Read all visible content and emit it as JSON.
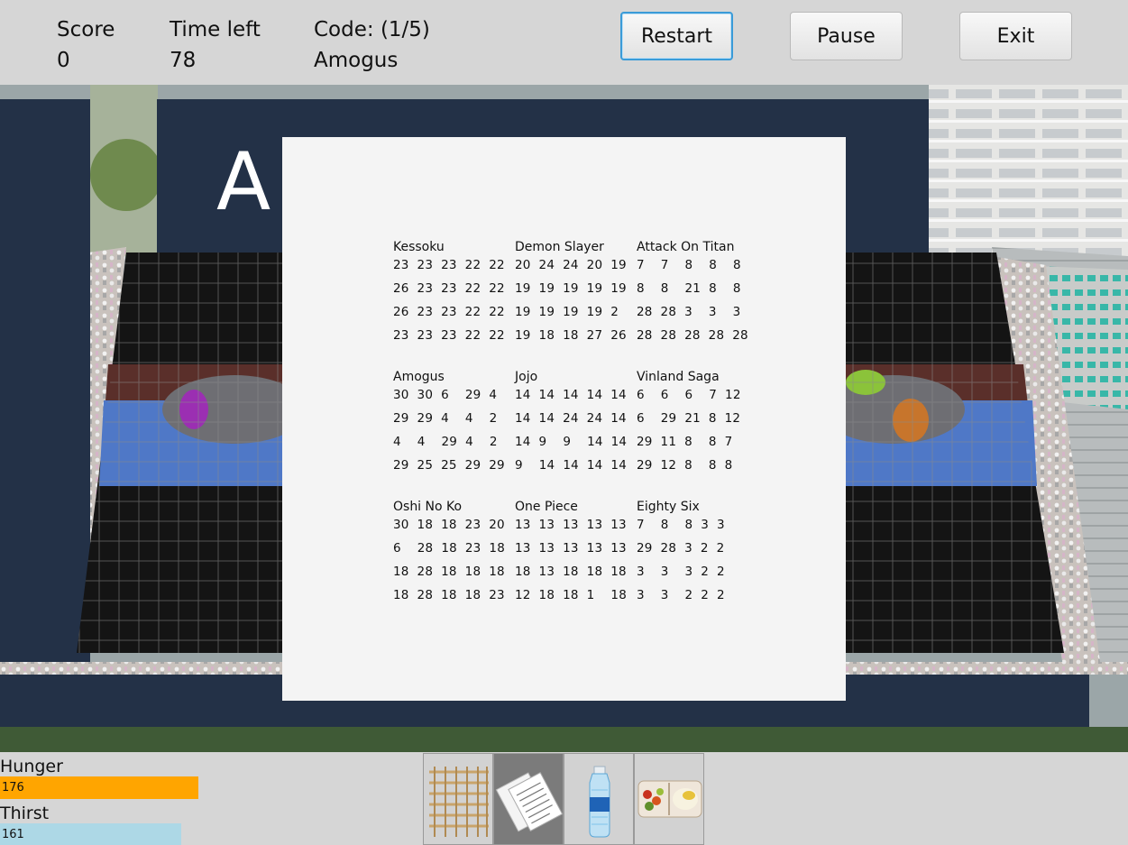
{
  "hud": {
    "score_label": "Score",
    "score_value": "0",
    "time_label": "Time left",
    "time_value": "78",
    "code_label": "Code: (1/5)",
    "code_value": "Amogus"
  },
  "buttons": {
    "restart": "Restart",
    "pause": "Pause",
    "exit": "Exit"
  },
  "scene": {
    "banner_text": "A                     n"
  },
  "code_sheet": {
    "groups": [
      {
        "name": "Kessoku",
        "rows": [
          "23  23  23  22  22",
          "26  23  23  22  22",
          "26  23  23  22  22",
          "23  23  23  22  22"
        ]
      },
      {
        "name": "Demon Slayer",
        "rows": [
          "20  24  24  20  19",
          "19  19  19  19  19",
          "19  19  19  19  2",
          "19  18  18  27  26"
        ]
      },
      {
        "name": "Attack On Titan",
        "rows": [
          "7    7    8    8    8",
          "8    8    21  8    8",
          "28  28  3    3    3",
          "28  28  28  28  28"
        ]
      },
      {
        "name": "Amogus",
        "rows": [
          "30  30  6    29  4",
          "29  29  4    4    2",
          "4    4    29  4    2",
          "29  25  25  29  29"
        ]
      },
      {
        "name": "Jojo",
        "rows": [
          "14  14  14  14  14",
          "14  14  24  24  14",
          "14  9    9    14  14",
          "9    14  14  14  14"
        ]
      },
      {
        "name": "Vinland Saga",
        "rows": [
          "6    6    6    7  12",
          "6    29  21  8  12",
          "29  11  8    8  7",
          "29  12  8    8  8"
        ]
      },
      {
        "name": "Oshi No Ko",
        "rows": [
          "30  18  18  23  20",
          "6    28  18  23  18",
          "18  28  18  18  18",
          "18  28  18  18  23"
        ]
      },
      {
        "name": "One Piece",
        "rows": [
          "13  13  13  13  13",
          "13  13  13  13  13",
          "18  13  18  18  18",
          "12  18  18  1    18"
        ]
      },
      {
        "name": "Eighty Six",
        "rows": [
          "7    8    8  3  3",
          "29  28  3  2  2",
          "3    3    3  2  2",
          "3    3    2  2  2"
        ]
      }
    ]
  },
  "status": {
    "hunger_label": "Hunger",
    "hunger_value": "176",
    "hunger_fraction": 0.88,
    "hunger_color": "#ffa500",
    "thirst_label": "Thirst",
    "thirst_value": "161",
    "thirst_fraction": 0.805,
    "thirst_color": "#add8e6"
  },
  "inventory": {
    "items": [
      {
        "icon": "placard-stick-icon",
        "selected": false
      },
      {
        "icon": "code-sheet-icon",
        "selected": true
      },
      {
        "icon": "water-bottle-icon",
        "selected": false
      },
      {
        "icon": "bento-box-icon",
        "selected": false
      }
    ]
  }
}
